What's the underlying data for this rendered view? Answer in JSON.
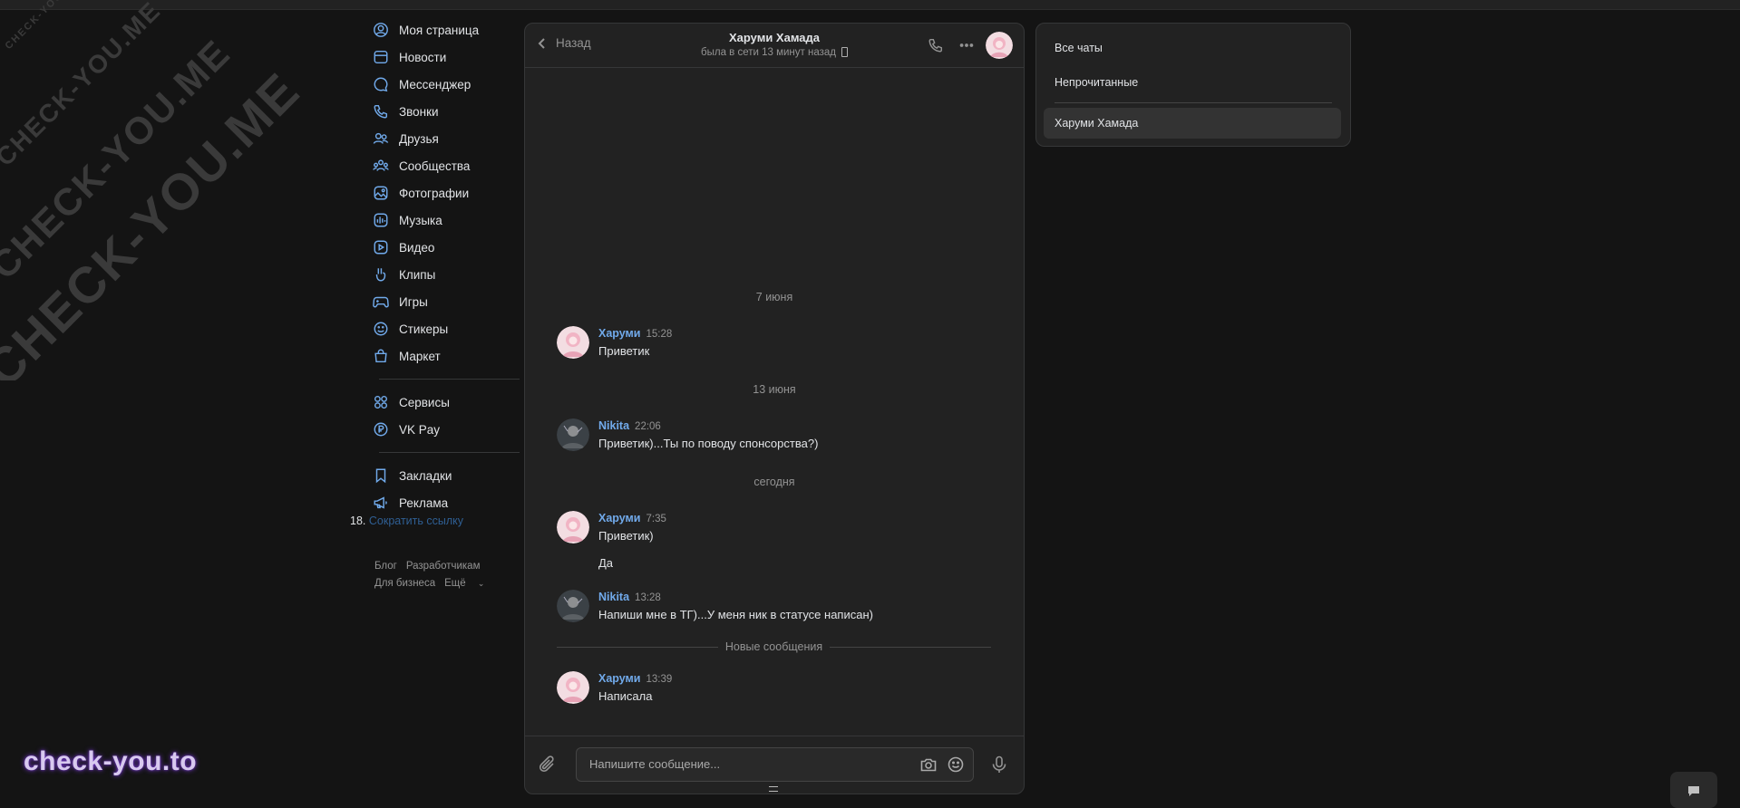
{
  "watermark": {
    "text": "CHECK-YOU.ME"
  },
  "nav": {
    "items": [
      {
        "label": "Моя страница",
        "icon": "user-icon"
      },
      {
        "label": "Новости",
        "icon": "news-icon"
      },
      {
        "label": "Мессенджер",
        "icon": "message-icon"
      },
      {
        "label": "Звонки",
        "icon": "phone-icon"
      },
      {
        "label": "Друзья",
        "icon": "friends-icon"
      },
      {
        "label": "Сообщества",
        "icon": "communities-icon"
      },
      {
        "label": "Фотографии",
        "icon": "photo-icon"
      },
      {
        "label": "Музыка",
        "icon": "music-icon"
      },
      {
        "label": "Видео",
        "icon": "video-icon"
      },
      {
        "label": "Клипы",
        "icon": "clips-icon"
      },
      {
        "label": "Игры",
        "icon": "gamepad-icon"
      },
      {
        "label": "Стикеры",
        "icon": "smile-icon"
      },
      {
        "label": "Маркет",
        "icon": "bag-icon"
      }
    ],
    "services": [
      {
        "label": "Сервисы",
        "icon": "grid-icon"
      },
      {
        "label": "VK Pay",
        "icon": "ruble-icon"
      }
    ],
    "extra": [
      {
        "label": "Закладки",
        "icon": "bookmark-icon"
      },
      {
        "label": "Реклама",
        "icon": "megaphone-icon"
      }
    ],
    "shortlink_number": "18.",
    "shortlink_label": "Сократить ссылку",
    "footer": {
      "blog": "Блог",
      "developers": "Разработчикам",
      "business": "Для бизнеса",
      "more": "Ещё"
    }
  },
  "chat": {
    "back_label": "Назад",
    "peer_name": "Харуми Хамада",
    "peer_status": "была в сети 13 минут назад",
    "dates": [
      "7 июня",
      "13 июня",
      "сегодня"
    ],
    "messages": [
      {
        "author": "Харуми",
        "time": "15:28",
        "lines": [
          "Приветик"
        ]
      },
      {
        "author": "Nikita",
        "time": "22:06",
        "lines": [
          "Приветик)...Ты по поводу спонсорства?)"
        ]
      },
      {
        "author": "Харуми",
        "time": "7:35",
        "lines": [
          "Приветик)",
          "Да"
        ]
      },
      {
        "author": "Nikita",
        "time": "13:28",
        "lines": [
          "Напиши мне в ТГ)...У меня ник в статусе написан)"
        ]
      },
      {
        "author": "Харуми",
        "time": "13:39",
        "lines": [
          "Написала"
        ]
      }
    ],
    "new_messages_label": "Новые сообщения",
    "input_placeholder": "Напишите сообщение..."
  },
  "folders": {
    "items": [
      "Все чаты",
      "Непрочитанные",
      "Харуми Хамада"
    ],
    "active": "Харуми Хамада"
  },
  "brand": "check-you.to",
  "colors": {
    "accent": "#71aaeb",
    "background": "#141414",
    "panel": "#222222"
  }
}
